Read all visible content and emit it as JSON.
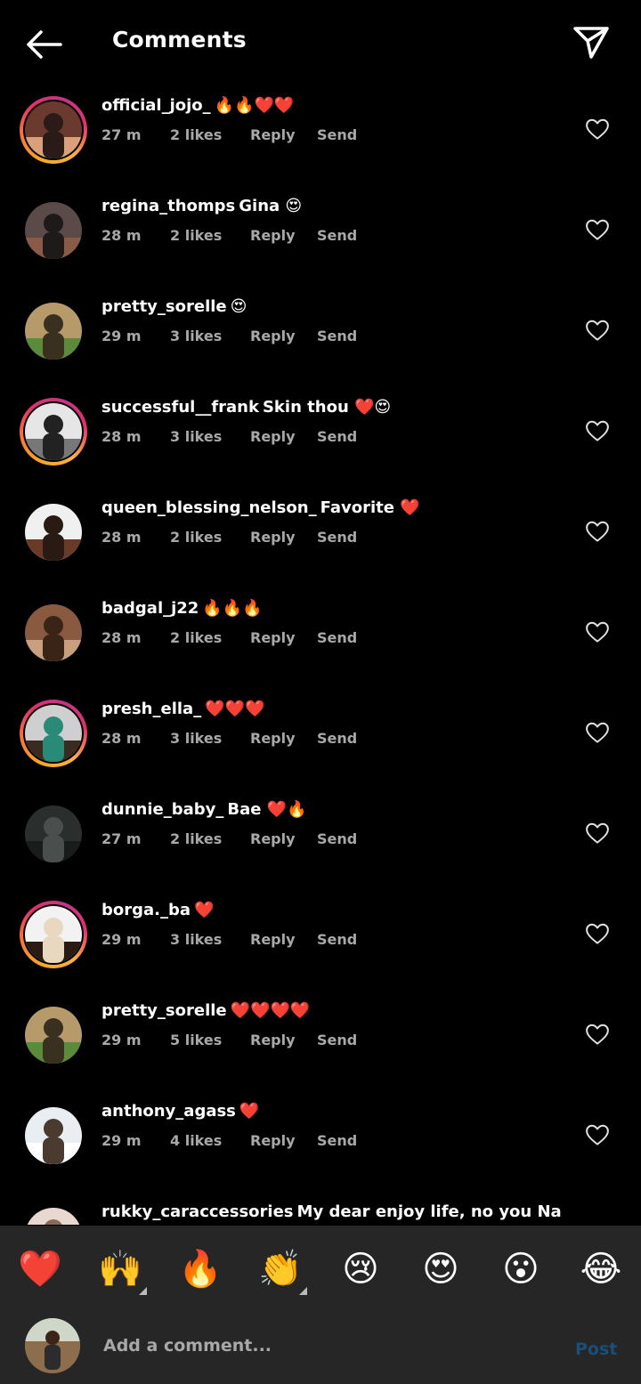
{
  "header": {
    "title": "Comments",
    "back_icon": "arrow-left-icon",
    "share_icon": "paper-plane-icon"
  },
  "comments": [
    {
      "username": "official_jojo_",
      "text": "🔥🔥❤️❤️",
      "time": "27 m",
      "likes": "2 likes",
      "reply": "Reply",
      "send": "Send",
      "story_ring": true
    },
    {
      "username": "regina_thomps",
      "text": "Gina 😍",
      "time": "28 m",
      "likes": "2 likes",
      "reply": "Reply",
      "send": "Send",
      "story_ring": false
    },
    {
      "username": "pretty_sorelle",
      "text": "😍",
      "time": "29 m",
      "likes": "3 likes",
      "reply": "Reply",
      "send": "Send",
      "story_ring": false
    },
    {
      "username": "successful__frank",
      "text": "Skin thou ❤️😍",
      "time": "28 m",
      "likes": "3 likes",
      "reply": "Reply",
      "send": "Send",
      "story_ring": true
    },
    {
      "username": "queen_blessing_nelson_",
      "text": "Favorite ❤️",
      "time": "28 m",
      "likes": "2 likes",
      "reply": "Reply",
      "send": "Send",
      "story_ring": false
    },
    {
      "username": "badgal_j22",
      "text": "🔥🔥🔥",
      "time": "28 m",
      "likes": "2 likes",
      "reply": "Reply",
      "send": "Send",
      "story_ring": false
    },
    {
      "username": "presh_ella_",
      "text": "❤️❤️❤️",
      "time": "28 m",
      "likes": "3 likes",
      "reply": "Reply",
      "send": "Send",
      "story_ring": true
    },
    {
      "username": "dunnie_baby_",
      "text": "Bae ❤️🔥",
      "time": "27 m",
      "likes": "2 likes",
      "reply": "Reply",
      "send": "Send",
      "story_ring": false
    },
    {
      "username": "borga._ba",
      "text": "❤️",
      "time": "29 m",
      "likes": "3 likes",
      "reply": "Reply",
      "send": "Send",
      "story_ring": true
    },
    {
      "username": "pretty_sorelle",
      "text": "❤️❤️❤️❤️",
      "time": "29 m",
      "likes": "5 likes",
      "reply": "Reply",
      "send": "Send",
      "story_ring": false
    },
    {
      "username": "anthony_agass",
      "text": "❤️",
      "time": "29 m",
      "likes": "4 likes",
      "reply": "Reply",
      "send": "Send",
      "story_ring": false
    },
    {
      "username": "rukky_caraccessories",
      "text": "My dear enjoy life, no you Na",
      "time": "",
      "likes": "",
      "reply": "",
      "send": "",
      "story_ring": false
    }
  ],
  "emoji_bar": [
    "❤️",
    "🙌",
    "🔥",
    "👏",
    "😢",
    "😍",
    "😮",
    "😂"
  ],
  "composer": {
    "placeholder": "Add a comment...",
    "post_label": "Post"
  },
  "colors": {
    "background": "#000000",
    "meta_text": "#a8a8a8",
    "bar_background": "#262626",
    "post_disabled": "#1a4f7a"
  }
}
